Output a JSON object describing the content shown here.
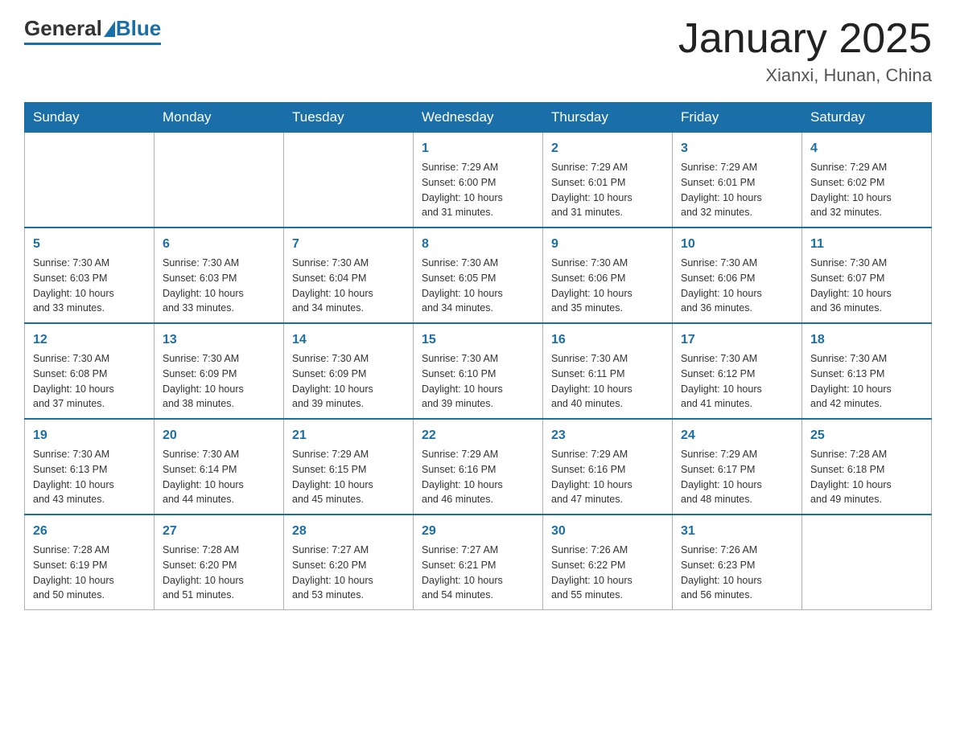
{
  "header": {
    "logo_general": "General",
    "logo_blue": "Blue",
    "month_title": "January 2025",
    "location": "Xianxi, Hunan, China"
  },
  "days_of_week": [
    "Sunday",
    "Monday",
    "Tuesday",
    "Wednesday",
    "Thursday",
    "Friday",
    "Saturday"
  ],
  "weeks": [
    [
      {
        "day": "",
        "info": ""
      },
      {
        "day": "",
        "info": ""
      },
      {
        "day": "",
        "info": ""
      },
      {
        "day": "1",
        "info": "Sunrise: 7:29 AM\nSunset: 6:00 PM\nDaylight: 10 hours\nand 31 minutes."
      },
      {
        "day": "2",
        "info": "Sunrise: 7:29 AM\nSunset: 6:01 PM\nDaylight: 10 hours\nand 31 minutes."
      },
      {
        "day": "3",
        "info": "Sunrise: 7:29 AM\nSunset: 6:01 PM\nDaylight: 10 hours\nand 32 minutes."
      },
      {
        "day": "4",
        "info": "Sunrise: 7:29 AM\nSunset: 6:02 PM\nDaylight: 10 hours\nand 32 minutes."
      }
    ],
    [
      {
        "day": "5",
        "info": "Sunrise: 7:30 AM\nSunset: 6:03 PM\nDaylight: 10 hours\nand 33 minutes."
      },
      {
        "day": "6",
        "info": "Sunrise: 7:30 AM\nSunset: 6:03 PM\nDaylight: 10 hours\nand 33 minutes."
      },
      {
        "day": "7",
        "info": "Sunrise: 7:30 AM\nSunset: 6:04 PM\nDaylight: 10 hours\nand 34 minutes."
      },
      {
        "day": "8",
        "info": "Sunrise: 7:30 AM\nSunset: 6:05 PM\nDaylight: 10 hours\nand 34 minutes."
      },
      {
        "day": "9",
        "info": "Sunrise: 7:30 AM\nSunset: 6:06 PM\nDaylight: 10 hours\nand 35 minutes."
      },
      {
        "day": "10",
        "info": "Sunrise: 7:30 AM\nSunset: 6:06 PM\nDaylight: 10 hours\nand 36 minutes."
      },
      {
        "day": "11",
        "info": "Sunrise: 7:30 AM\nSunset: 6:07 PM\nDaylight: 10 hours\nand 36 minutes."
      }
    ],
    [
      {
        "day": "12",
        "info": "Sunrise: 7:30 AM\nSunset: 6:08 PM\nDaylight: 10 hours\nand 37 minutes."
      },
      {
        "day": "13",
        "info": "Sunrise: 7:30 AM\nSunset: 6:09 PM\nDaylight: 10 hours\nand 38 minutes."
      },
      {
        "day": "14",
        "info": "Sunrise: 7:30 AM\nSunset: 6:09 PM\nDaylight: 10 hours\nand 39 minutes."
      },
      {
        "day": "15",
        "info": "Sunrise: 7:30 AM\nSunset: 6:10 PM\nDaylight: 10 hours\nand 39 minutes."
      },
      {
        "day": "16",
        "info": "Sunrise: 7:30 AM\nSunset: 6:11 PM\nDaylight: 10 hours\nand 40 minutes."
      },
      {
        "day": "17",
        "info": "Sunrise: 7:30 AM\nSunset: 6:12 PM\nDaylight: 10 hours\nand 41 minutes."
      },
      {
        "day": "18",
        "info": "Sunrise: 7:30 AM\nSunset: 6:13 PM\nDaylight: 10 hours\nand 42 minutes."
      }
    ],
    [
      {
        "day": "19",
        "info": "Sunrise: 7:30 AM\nSunset: 6:13 PM\nDaylight: 10 hours\nand 43 minutes."
      },
      {
        "day": "20",
        "info": "Sunrise: 7:30 AM\nSunset: 6:14 PM\nDaylight: 10 hours\nand 44 minutes."
      },
      {
        "day": "21",
        "info": "Sunrise: 7:29 AM\nSunset: 6:15 PM\nDaylight: 10 hours\nand 45 minutes."
      },
      {
        "day": "22",
        "info": "Sunrise: 7:29 AM\nSunset: 6:16 PM\nDaylight: 10 hours\nand 46 minutes."
      },
      {
        "day": "23",
        "info": "Sunrise: 7:29 AM\nSunset: 6:16 PM\nDaylight: 10 hours\nand 47 minutes."
      },
      {
        "day": "24",
        "info": "Sunrise: 7:29 AM\nSunset: 6:17 PM\nDaylight: 10 hours\nand 48 minutes."
      },
      {
        "day": "25",
        "info": "Sunrise: 7:28 AM\nSunset: 6:18 PM\nDaylight: 10 hours\nand 49 minutes."
      }
    ],
    [
      {
        "day": "26",
        "info": "Sunrise: 7:28 AM\nSunset: 6:19 PM\nDaylight: 10 hours\nand 50 minutes."
      },
      {
        "day": "27",
        "info": "Sunrise: 7:28 AM\nSunset: 6:20 PM\nDaylight: 10 hours\nand 51 minutes."
      },
      {
        "day": "28",
        "info": "Sunrise: 7:27 AM\nSunset: 6:20 PM\nDaylight: 10 hours\nand 53 minutes."
      },
      {
        "day": "29",
        "info": "Sunrise: 7:27 AM\nSunset: 6:21 PM\nDaylight: 10 hours\nand 54 minutes."
      },
      {
        "day": "30",
        "info": "Sunrise: 7:26 AM\nSunset: 6:22 PM\nDaylight: 10 hours\nand 55 minutes."
      },
      {
        "day": "31",
        "info": "Sunrise: 7:26 AM\nSunset: 6:23 PM\nDaylight: 10 hours\nand 56 minutes."
      },
      {
        "day": "",
        "info": ""
      }
    ]
  ]
}
